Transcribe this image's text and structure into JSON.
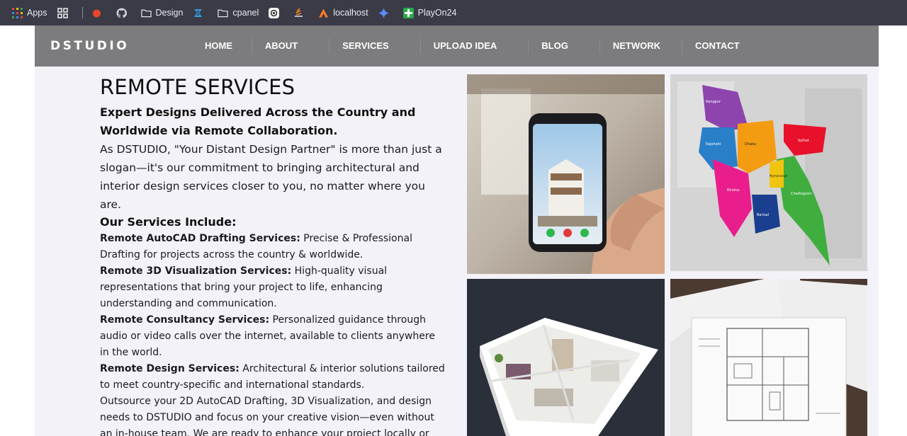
{
  "bookmarks": [
    {
      "label": "Apps",
      "icon": "apps-grid-icon"
    },
    {
      "label": "",
      "icon": "grid-icon"
    },
    {
      "label": "",
      "icon": "red-dot-icon"
    },
    {
      "label": "",
      "icon": "github-icon"
    },
    {
      "label": "Design",
      "icon": "folder-icon"
    },
    {
      "label": "",
      "icon": "blue-logo-icon"
    },
    {
      "label": "cpanel",
      "icon": "folder-icon"
    },
    {
      "label": "",
      "icon": "openai-icon"
    },
    {
      "label": "",
      "icon": "stack-icon"
    },
    {
      "label": "localhost",
      "icon": "xampp-icon"
    },
    {
      "label": "",
      "icon": "sparkle-icon"
    },
    {
      "label": "PlayOn24",
      "icon": "green-cross-icon"
    }
  ],
  "site": {
    "logo": "DSTUDIO",
    "menu": [
      "HOME",
      "ABOUT",
      "SERVICES",
      "UPLOAD IDEA",
      "BLOG",
      "NETWORK",
      "CONTACT"
    ]
  },
  "main": {
    "title": "REMOTE SERVICES",
    "lead": "Expert Designs Delivered Across the Country and Worldwide via Remote Collaboration.",
    "intro": "As DSTUDIO, \"Your Distant Design Partner\" is more than just a slogan—it's our commitment to bringing architectural and interior design services closer to you, no matter where you are.",
    "services_heading": "Our Services Include:",
    "services": [
      {
        "name": "Remote AutoCAD Drafting Services:",
        "desc": " Precise & Professional Drafting for projects across the country & worldwide."
      },
      {
        "name": "Remote 3D Visualization Services:",
        "desc": " High-quality visual representations that bring your project to life, enhancing understanding and communication."
      },
      {
        "name": "Remote Consultancy Services:",
        "desc": " Personalized guidance through audio or video calls over the internet, available to clients anywhere in the world."
      },
      {
        "name": "Remote Design Services:",
        "desc": " Architectural & interior solutions tailored to meet country-specific and international standards."
      }
    ],
    "outro": "Outsource your 2D AutoCAD Drafting, 3D Visualization, and design needs to DSTUDIO and focus on your creative vision—even without an in-house team. We are ready to enhance your project locally or"
  },
  "map_labels": [
    "Rangpur",
    "Rajshahi",
    "Dhaka",
    "Sylhet",
    "Khulna",
    "Barisal",
    "Chattogram",
    "Mymensingh"
  ],
  "colors": {
    "nav": "#7c7c7e",
    "bookmarks_bg": "#3a3b47",
    "page_bg": "#f3f2f8"
  }
}
